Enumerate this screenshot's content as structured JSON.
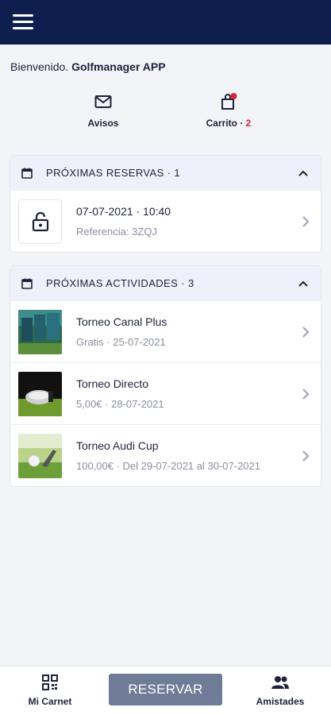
{
  "header": {
    "menu_icon": "hamburger-icon",
    "background": "#0f1f4d"
  },
  "welcome": {
    "prefix": "Bienvenido.",
    "name": "Golfmanager APP"
  },
  "quick_links": [
    {
      "icon": "envelope-icon",
      "label": "Avisos"
    },
    {
      "icon": "cart-icon",
      "label": "Carrito",
      "separator": " · ",
      "count": "2"
    }
  ],
  "reservations": {
    "title": "PRÓXIMAS RESERVAS · 1",
    "items": [
      {
        "title": "07-07-2021 · 10:40",
        "subtitle": "Referencia: 3ZQJ",
        "icon": "unlocked-padlock-icon"
      }
    ]
  },
  "activities": {
    "title": "PRÓXIMAS ACTIVIDADES · 3",
    "items": [
      {
        "title": "Torneo Canal Plus",
        "subtitle": "Gratis · 25-07-2021"
      },
      {
        "title": "Torneo Directo",
        "subtitle": "5,00€ · 28-07-2021"
      },
      {
        "title": "Torneo Audi Cup",
        "subtitle": "100,00€ · Del 29-07-2021 al 30-07-2021"
      }
    ]
  },
  "bottom_nav": {
    "carnet_label": "Mi Carnet",
    "reserve_label": "RESERVAR",
    "friends_label": "Amistades"
  },
  "colors": {
    "accent": "#0f1f4d",
    "badge": "#d8262f",
    "button": "#6f7c97"
  }
}
